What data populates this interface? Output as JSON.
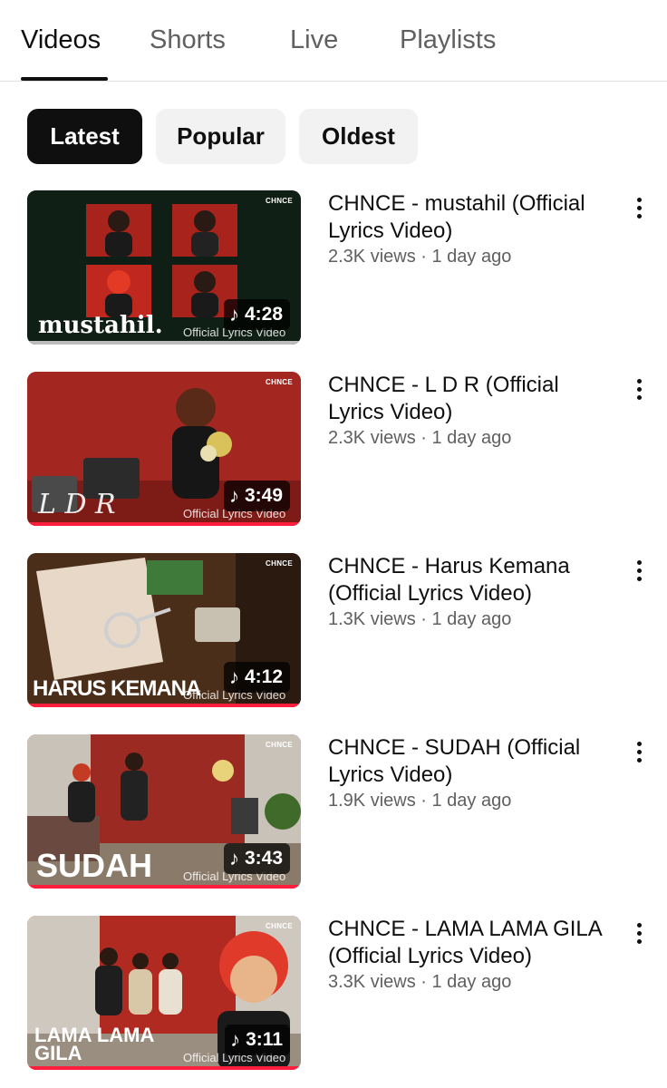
{
  "tabs": [
    {
      "label": "Videos",
      "active": true
    },
    {
      "label": "Shorts",
      "active": false
    },
    {
      "label": "Live",
      "active": false
    },
    {
      "label": "Playlists",
      "active": false
    }
  ],
  "chips": [
    {
      "label": "Latest",
      "active": true
    },
    {
      "label": "Popular",
      "active": false
    },
    {
      "label": "Oldest",
      "active": false
    }
  ],
  "videos": [
    {
      "title": "CHNCE - mustahil (Official Lyrics Video)",
      "views": "2.3K views",
      "age": "1 day ago",
      "meta": "2.3K views · 1 day ago",
      "duration": "4:28",
      "thumb_brand": "CHNCE",
      "thumb_title": "mustahil.",
      "thumb_subtitle": "Official Lyrics Video",
      "thumb_bg": "#0f1f15",
      "progress_color": "#bdbdbd"
    },
    {
      "title": "CHNCE - L D R (Official Lyrics Video)",
      "views": "2.3K views",
      "age": "1 day ago",
      "meta": "2.3K views · 1 day ago",
      "duration": "3:49",
      "thumb_brand": "CHNCE",
      "thumb_title": "L D R",
      "thumb_subtitle": "Official Lyrics Video",
      "thumb_bg": "#a32620",
      "progress_color": "#ff1e3c"
    },
    {
      "title": "CHNCE - Harus Kemana (Official Lyrics Video)",
      "views": "1.3K views",
      "age": "1 day ago",
      "meta": "1.3K views · 1 day ago",
      "duration": "4:12",
      "thumb_brand": "CHNCE",
      "thumb_title": "HARUS KEMANA",
      "thumb_subtitle": "Official Lyrics Video",
      "thumb_bg": "#5a3a20",
      "progress_color": "#ff1e3c"
    },
    {
      "title": "CHNCE - SUDAH (Official Lyrics Video)",
      "views": "1.9K views",
      "age": "1 day ago",
      "meta": "1.9K views · 1 day ago",
      "duration": "3:43",
      "thumb_brand": "CHNCE",
      "thumb_title": "SUDAH",
      "thumb_subtitle": "Official Lyrics Video",
      "thumb_bg": "#9a2a22",
      "progress_color": "#ff1e3c"
    },
    {
      "title": "CHNCE - LAMA LAMA GILA (Official Lyrics Video)",
      "views": "3.3K views",
      "age": "1 day ago",
      "meta": "3.3K views · 1 day ago",
      "duration": "3:11",
      "thumb_brand": "CHNCE",
      "thumb_title": "LAMA LAMA GILA",
      "thumb_subtitle": "Official Lyrics Video",
      "thumb_bg": "#b02a22",
      "progress_color": "#ff1e3c"
    }
  ]
}
